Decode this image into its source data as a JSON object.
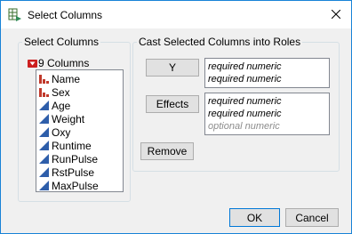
{
  "window": {
    "title": "Select Columns"
  },
  "select_columns": {
    "group_label": "Select Columns",
    "count_label": "9 Columns",
    "items": [
      {
        "label": "Name",
        "type": "nominal"
      },
      {
        "label": "Sex",
        "type": "nominal"
      },
      {
        "label": "Age",
        "type": "continuous"
      },
      {
        "label": "Weight",
        "type": "continuous"
      },
      {
        "label": "Oxy",
        "type": "continuous"
      },
      {
        "label": "Runtime",
        "type": "continuous"
      },
      {
        "label": "RunPulse",
        "type": "continuous"
      },
      {
        "label": "RstPulse",
        "type": "continuous"
      },
      {
        "label": "MaxPulse",
        "type": "continuous"
      }
    ]
  },
  "roles": {
    "group_label": "Cast Selected Columns into Roles",
    "y": {
      "button_label": "Y",
      "lines": [
        "required numeric",
        "required numeric"
      ]
    },
    "effects": {
      "button_label": "Effects",
      "lines": [
        "required numeric",
        "required numeric",
        "optional numeric"
      ]
    },
    "remove_label": "Remove"
  },
  "footer": {
    "ok_label": "OK",
    "cancel_label": "Cancel"
  },
  "colors": {
    "nominal_icon": "#c0392b",
    "continuous_icon": "#2e5eaa",
    "collapse_icon": "#cc1f1f",
    "accent": "#0078d7"
  }
}
